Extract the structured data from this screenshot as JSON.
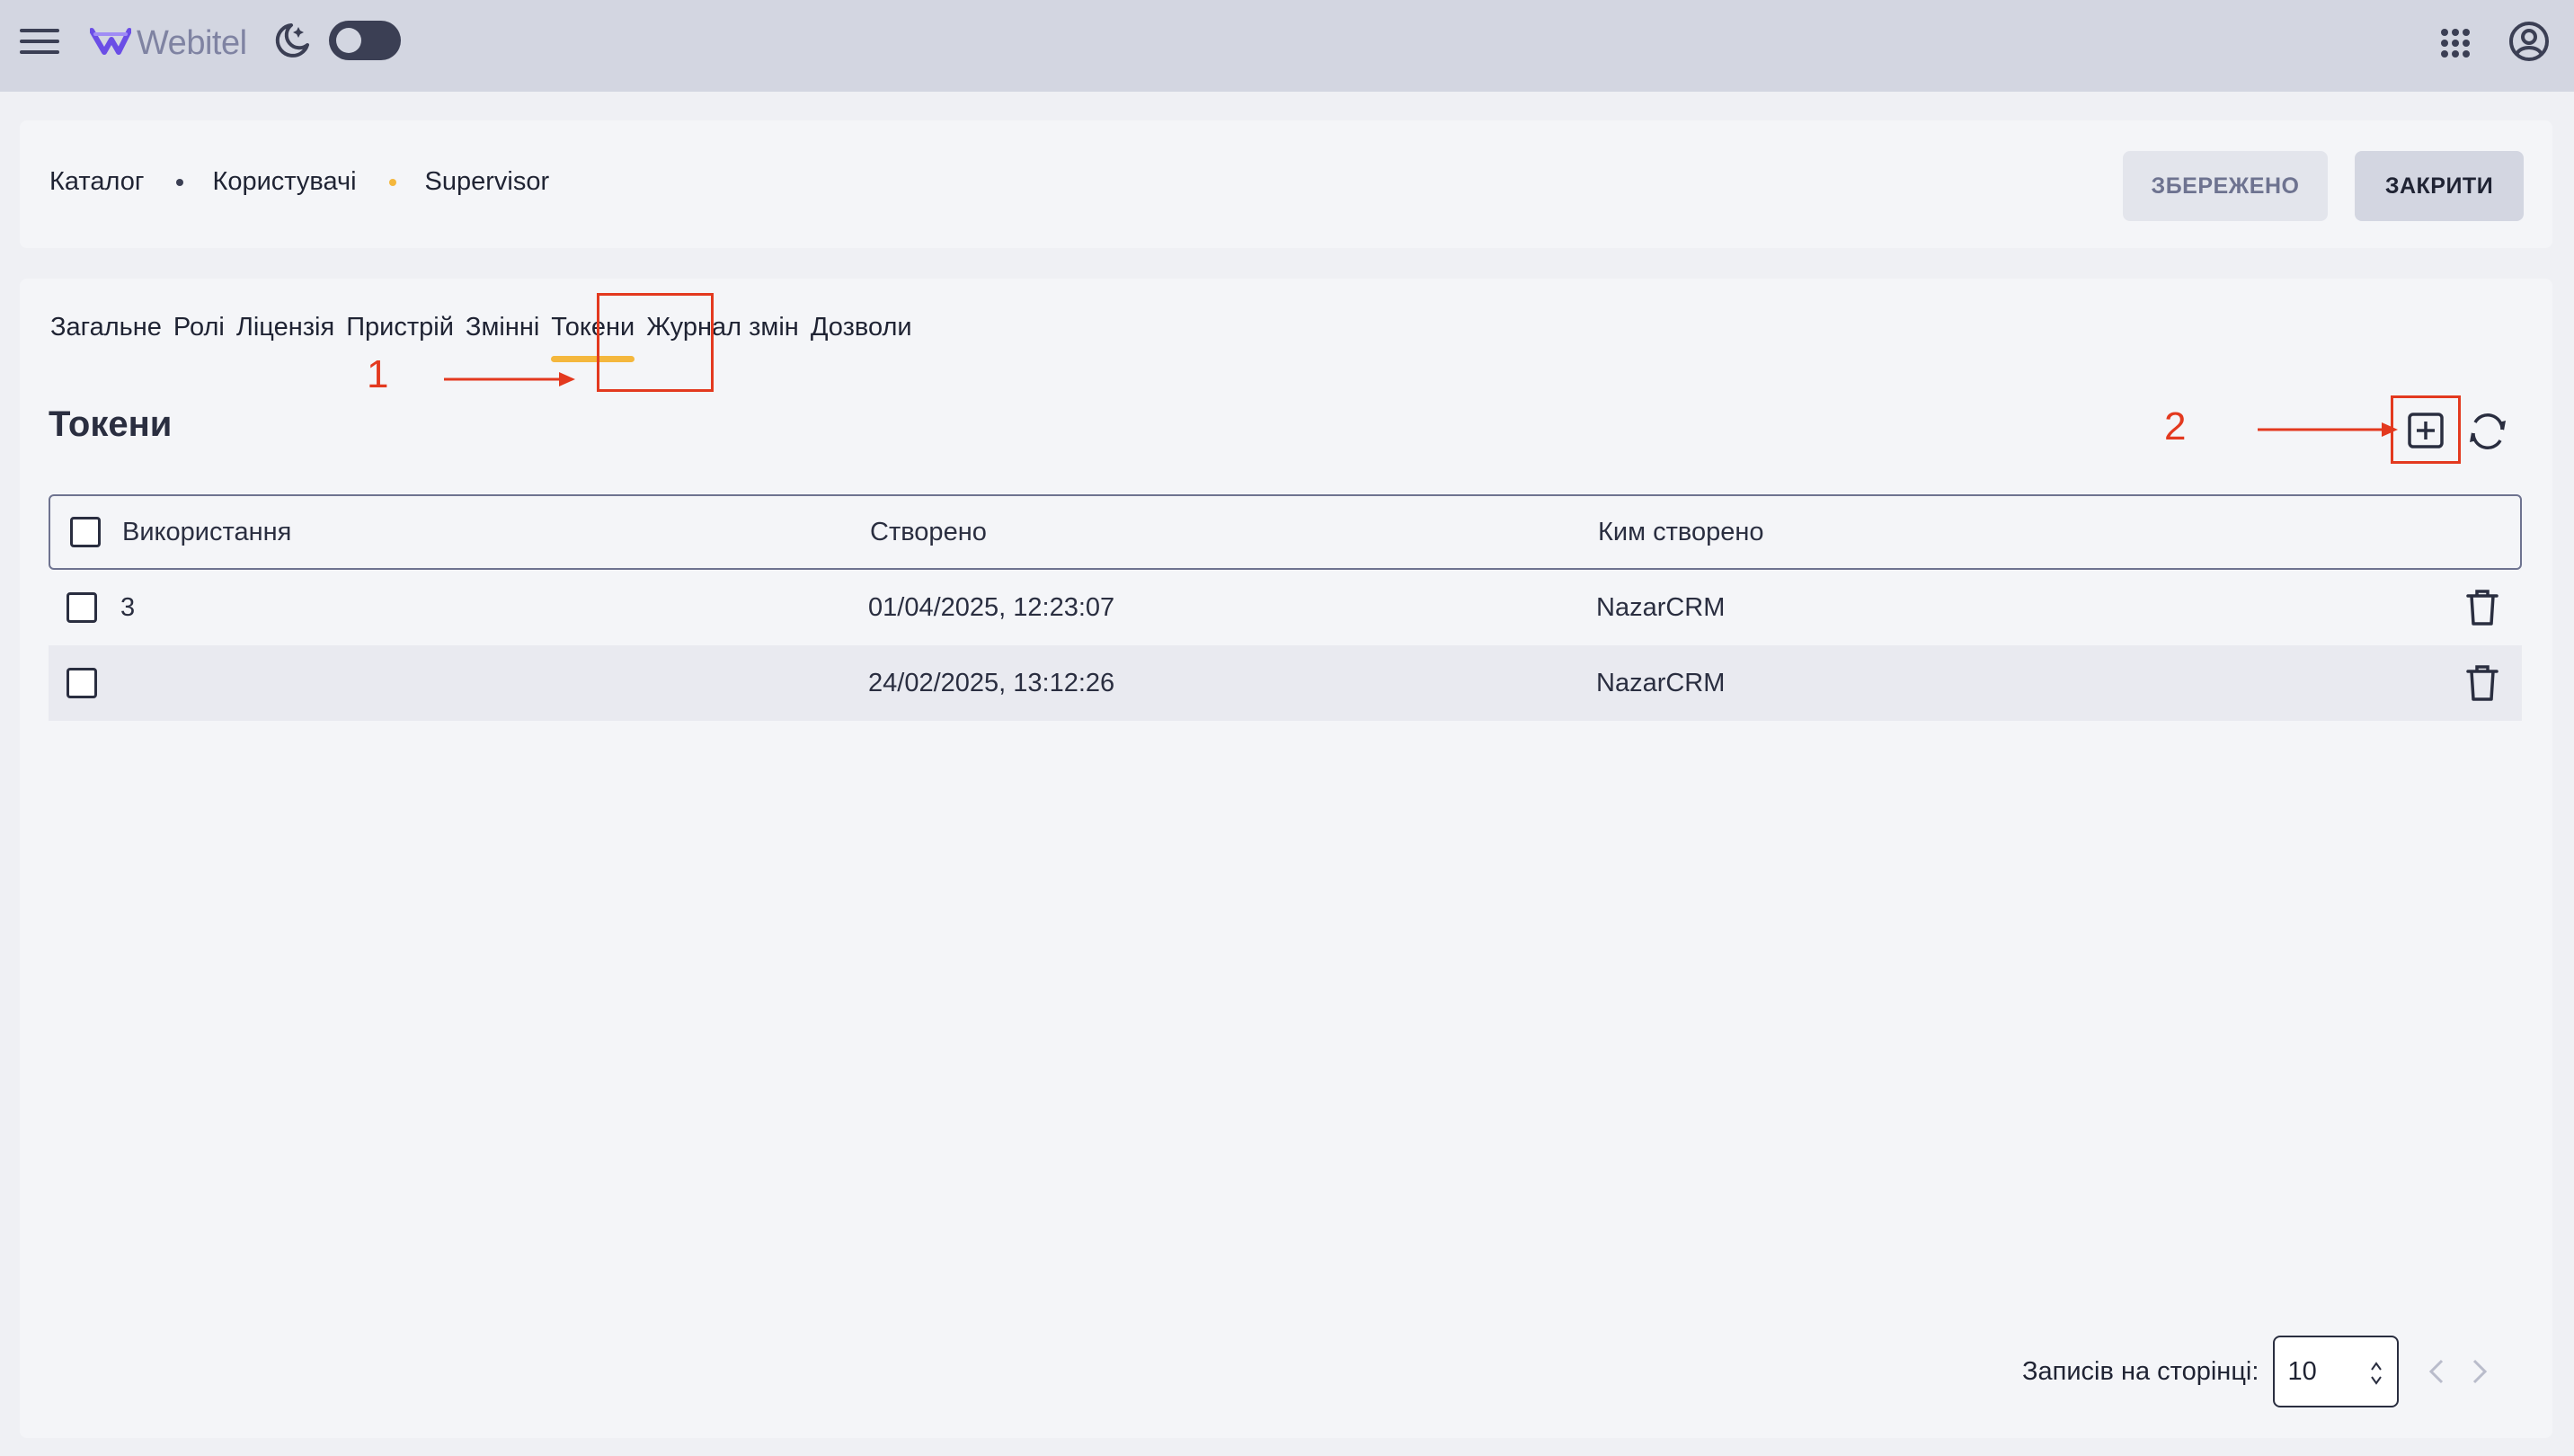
{
  "topbar": {
    "logo_text": "Webitel",
    "icons": [
      "menu-icon",
      "webitel-logo",
      "moon-icon",
      "theme-toggle",
      "apps-grid-icon",
      "account-icon"
    ]
  },
  "header": {
    "breadcrumb": [
      "Каталог",
      "Користувачі",
      "Supervisor"
    ],
    "saved_label": "ЗБЕРЕЖЕНО",
    "close_label": "ЗАКРИТИ"
  },
  "tabs": [
    "Загальне",
    "Ролі",
    "Ліцензія",
    "Пристрій",
    "Змінні",
    "Токени",
    "Журнал змін",
    "Дозволи"
  ],
  "active_tab": "Токени",
  "annotations": {
    "first": "1",
    "second": "2"
  },
  "section": {
    "title": "Токени"
  },
  "table": {
    "columns": [
      "Використання",
      "Створено",
      "Ким створено"
    ],
    "rows": [
      {
        "usage": "3",
        "created": "01/04/2025, 12:23:07",
        "created_by": "NazarCRM"
      },
      {
        "usage": "",
        "created": "24/02/2025, 13:12:26",
        "created_by": "NazarCRM"
      }
    ]
  },
  "pagination": {
    "label": "Записів на сторінці:",
    "per_page": "10"
  },
  "colors": {
    "accent": "#f4b73d",
    "annotation": "#e3391f",
    "brand": "#6b4ee6"
  }
}
